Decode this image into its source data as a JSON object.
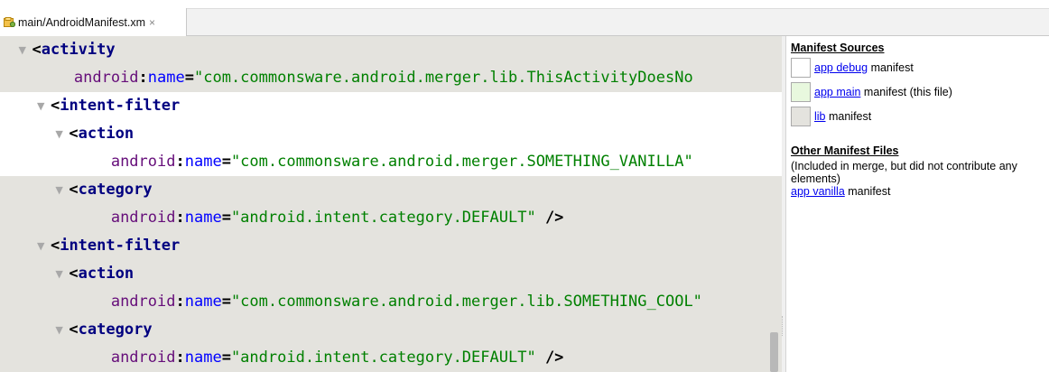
{
  "tab": {
    "label": "main/AndroidManifest.xm",
    "close": "×"
  },
  "editor": {
    "lines": [
      {
        "indent": "  ",
        "parts": [
          {
            "c": "punc",
            "t": "<"
          },
          {
            "c": "tag",
            "t": "activity"
          }
        ]
      },
      {
        "indent": "    ",
        "parts": [
          {
            "c": "ns",
            "t": "android"
          },
          {
            "c": "punc",
            "t": ":"
          },
          {
            "c": "attr",
            "t": "name"
          },
          {
            "c": "punc",
            "t": "="
          },
          {
            "c": "val",
            "t": "\"com.commonsware.android.merger.lib.ThisActivityDoesNo"
          }
        ]
      },
      {
        "indent": "   ",
        "parts": [
          {
            "c": "punc",
            "t": "<"
          },
          {
            "c": "tag",
            "t": "intent-filter"
          }
        ]
      },
      {
        "indent": "    ",
        "parts": [
          {
            "c": "punc",
            "t": "<"
          },
          {
            "c": "tag",
            "t": "action"
          }
        ]
      },
      {
        "indent": "      ",
        "parts": [
          {
            "c": "ns",
            "t": "android"
          },
          {
            "c": "punc",
            "t": ":"
          },
          {
            "c": "attr",
            "t": "name"
          },
          {
            "c": "punc",
            "t": "="
          },
          {
            "c": "val",
            "t": "\"com.commonsware.android.merger.SOMETHING_VANILLA\""
          }
        ]
      },
      {
        "indent": "    ",
        "parts": [
          {
            "c": "punc",
            "t": "<"
          },
          {
            "c": "tag",
            "t": "category"
          }
        ]
      },
      {
        "indent": "      ",
        "parts": [
          {
            "c": "ns",
            "t": "android"
          },
          {
            "c": "punc",
            "t": ":"
          },
          {
            "c": "attr",
            "t": "name"
          },
          {
            "c": "punc",
            "t": "="
          },
          {
            "c": "val",
            "t": "\"android.intent.category.DEFAULT\""
          },
          {
            "c": "punc",
            "t": " />"
          }
        ]
      },
      {
        "indent": "   ",
        "parts": [
          {
            "c": "punc",
            "t": "<"
          },
          {
            "c": "tag",
            "t": "intent-filter"
          }
        ]
      },
      {
        "indent": "    ",
        "parts": [
          {
            "c": "punc",
            "t": "<"
          },
          {
            "c": "tag",
            "t": "action"
          }
        ]
      },
      {
        "indent": "      ",
        "parts": [
          {
            "c": "ns",
            "t": "android"
          },
          {
            "c": "punc",
            "t": ":"
          },
          {
            "c": "attr",
            "t": "name"
          },
          {
            "c": "punc",
            "t": "="
          },
          {
            "c": "val",
            "t": "\"com.commonsware.android.merger.lib.SOMETHING_COOL\""
          }
        ]
      },
      {
        "indent": "    ",
        "parts": [
          {
            "c": "punc",
            "t": "<"
          },
          {
            "c": "tag",
            "t": "category"
          }
        ]
      },
      {
        "indent": "      ",
        "parts": [
          {
            "c": "ns",
            "t": "android"
          },
          {
            "c": "punc",
            "t": ":"
          },
          {
            "c": "attr",
            "t": "name"
          },
          {
            "c": "punc",
            "t": "="
          },
          {
            "c": "val",
            "t": "\"android.intent.category.DEFAULT\""
          },
          {
            "c": "punc",
            "t": " />"
          }
        ]
      }
    ]
  },
  "sources": {
    "heading": "Manifest Sources",
    "items": [
      {
        "link": "app debug",
        "suffix": " manifest",
        "swatch": "#ffffff"
      },
      {
        "link": "app main",
        "suffix": " manifest (this file)",
        "swatch": "#e8f8de"
      },
      {
        "link": "lib",
        "suffix": " manifest",
        "swatch": "#e4e3de"
      }
    ]
  },
  "other": {
    "heading": "Other Manifest Files",
    "note": "(Included in merge, but did not contribute any elements)",
    "link": "app vanilla",
    "suffix": " manifest"
  },
  "colors": {
    "editor_bg": "#e4e3de",
    "highlight_bg": "#ffffff",
    "tag": "#000080",
    "attr": "#0000ff",
    "value": "#008000",
    "link": "#0000ee"
  }
}
